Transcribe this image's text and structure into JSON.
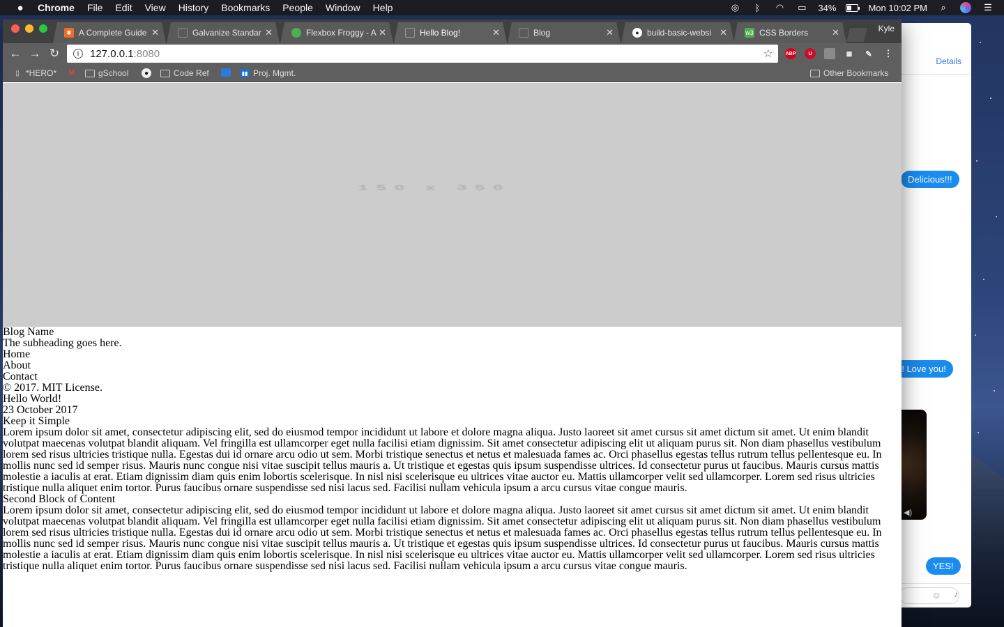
{
  "menubar": {
    "app": "Chrome",
    "menus": [
      "File",
      "Edit",
      "View",
      "History",
      "Bookmarks",
      "People",
      "Window",
      "Help"
    ],
    "battery": "34%",
    "clock": "Mon 10:02 PM"
  },
  "messages": {
    "details": "Details",
    "bubbles": [
      "Delicious!!!",
      "o! Love you!",
      "YES!"
    ]
  },
  "tabs": [
    {
      "title": "A Complete Guide",
      "icon": "css-tricks-icon",
      "color": "#f26b21"
    },
    {
      "title": "Galvanize Standar",
      "icon": "page-icon",
      "color": "#777777"
    },
    {
      "title": "Flexbox Froggy - A",
      "icon": "frog-icon",
      "color": "#4caf50"
    },
    {
      "title": "Hello Blog!",
      "icon": "page-icon",
      "color": "#777777"
    },
    {
      "title": "Blog",
      "icon": "page-icon",
      "color": "#777777"
    },
    {
      "title": "build-basic-websi",
      "icon": "github-icon",
      "color": "#222222"
    },
    {
      "title": "CSS Borders",
      "icon": "w3schools-icon",
      "color": "#4caf50"
    }
  ],
  "profile": "Kyle",
  "address": {
    "host": "127.0.0.1",
    "port": ":8080"
  },
  "bookmarks": [
    {
      "label": "*HERO*",
      "icon": "page-icon"
    },
    {
      "label": "",
      "icon": "gmail-icon"
    },
    {
      "label": "gSchool",
      "icon": "folder-icon"
    },
    {
      "label": "",
      "icon": "github-icon"
    },
    {
      "label": "Code Ref",
      "icon": "folder-icon"
    },
    {
      "label": "",
      "icon": "pivotal-icon"
    },
    {
      "label": "Proj. Mgmt.",
      "icon": "trello-icon"
    }
  ],
  "other_bookmarks": "Other Bookmarks",
  "hero": {
    "placeholder": "150 x 350"
  },
  "page": {
    "blog_name": "Blog Name",
    "subheading": "The subheading goes here.",
    "nav": [
      "Home",
      "About",
      "Contact"
    ],
    "copyright": "© 2017. MIT License.",
    "post_title": "Hello World!",
    "post_date": "23 October 2017",
    "section1_title": "Keep it Simple",
    "section1_body": "Lorem ipsum dolor sit amet, consectetur adipiscing elit, sed do eiusmod tempor incididunt ut labore et dolore magna aliqua. Justo laoreet sit amet cursus sit amet dictum sit amet. Ut enim blandit volutpat maecenas volutpat blandit aliquam. Vel fringilla est ullamcorper eget nulla facilisi etiam dignissim. Sit amet consectetur adipiscing elit ut aliquam purus sit. Non diam phasellus vestibulum lorem sed risus ultricies tristique nulla. Egestas dui id ornare arcu odio ut sem. Morbi tristique senectus et netus et malesuada fames ac. Orci phasellus egestas tellus rutrum tellus pellentesque eu. In mollis nunc sed id semper risus. Mauris nunc congue nisi vitae suscipit tellus mauris a. Ut tristique et egestas quis ipsum suspendisse ultrices. Id consectetur purus ut faucibus. Mauris cursus mattis molestie a iaculis at erat. Etiam dignissim diam quis enim lobortis scelerisque. In nisl nisi scelerisque eu ultrices vitae auctor eu. Mattis ullamcorper velit sed ullamcorper. Lorem sed risus ultricies tristique nulla aliquet enim tortor. Purus faucibus ornare suspendisse sed nisi lacus sed. Facilisi nullam vehicula ipsum a arcu cursus vitae congue mauris.",
    "section2_title": "Second Block of Content",
    "section2_body": "Lorem ipsum dolor sit amet, consectetur adipiscing elit, sed do eiusmod tempor incididunt ut labore et dolore magna aliqua. Justo laoreet sit amet cursus sit amet dictum sit amet. Ut enim blandit volutpat maecenas volutpat blandit aliquam. Vel fringilla est ullamcorper eget nulla facilisi etiam dignissim. Sit amet consectetur adipiscing elit ut aliquam purus sit. Non diam phasellus vestibulum lorem sed risus ultricies tristique nulla. Egestas dui id ornare arcu odio ut sem. Morbi tristique senectus et netus et malesuada fames ac. Orci phasellus egestas tellus rutrum tellus pellentesque eu. In mollis nunc sed id semper risus. Mauris nunc congue nisi vitae suscipit tellus mauris a. Ut tristique et egestas quis ipsum suspendisse ultrices. Id consectetur purus ut faucibus. Mauris cursus mattis molestie a iaculis at erat. Etiam dignissim diam quis enim lobortis scelerisque. In nisl nisi scelerisque eu ultrices vitae auctor eu. Mattis ullamcorper velit sed ullamcorper. Lorem sed risus ultricies tristique nulla aliquet enim tortor. Purus faucibus ornare suspendisse sed nisi lacus sed. Facilisi nullam vehicula ipsum a arcu cursus vitae congue mauris."
  }
}
